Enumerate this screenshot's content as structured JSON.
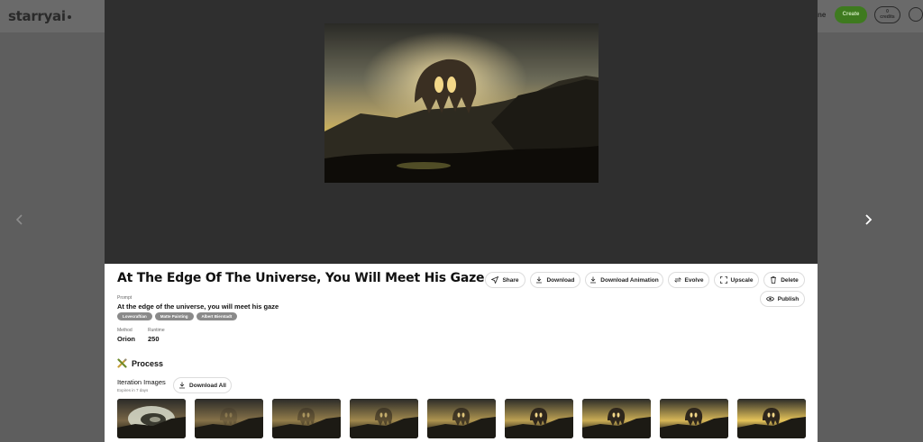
{
  "app": {
    "logo": "starryai",
    "header_fragment": "ne",
    "create_label": "Create",
    "credits_count": "0",
    "credits_label": "credits"
  },
  "artwork": {
    "title": "At The Edge Of The Universe, You Will Meet His Gaze",
    "actions": {
      "share": "Share",
      "download": "Download",
      "download_animation": "Download Animation",
      "evolve": "Evolve",
      "upscale": "Upscale",
      "delete": "Delete",
      "publish": "Publish"
    },
    "prompt_label": "Prompt",
    "prompt": "At the edge of the universe, you will meet his gaze",
    "tags": [
      "Lovecraftian",
      "Matte Painting",
      "Albert Bierstadt"
    ],
    "method_label": "Method",
    "method": "Orion",
    "runtime_label": "Runtime",
    "runtime": "250"
  },
  "process": {
    "title": "Process",
    "iteration_title": "Iteration Images",
    "iteration_sub": "Expires in 7 days",
    "download_all": "Download All",
    "thumbnail_count": 9
  },
  "colors": {
    "overlay": "#5e5e5e",
    "viewer_bg": "#2f2f2f",
    "create_green": "#3e7a1f",
    "tag_gray": "#8a8a8a"
  }
}
